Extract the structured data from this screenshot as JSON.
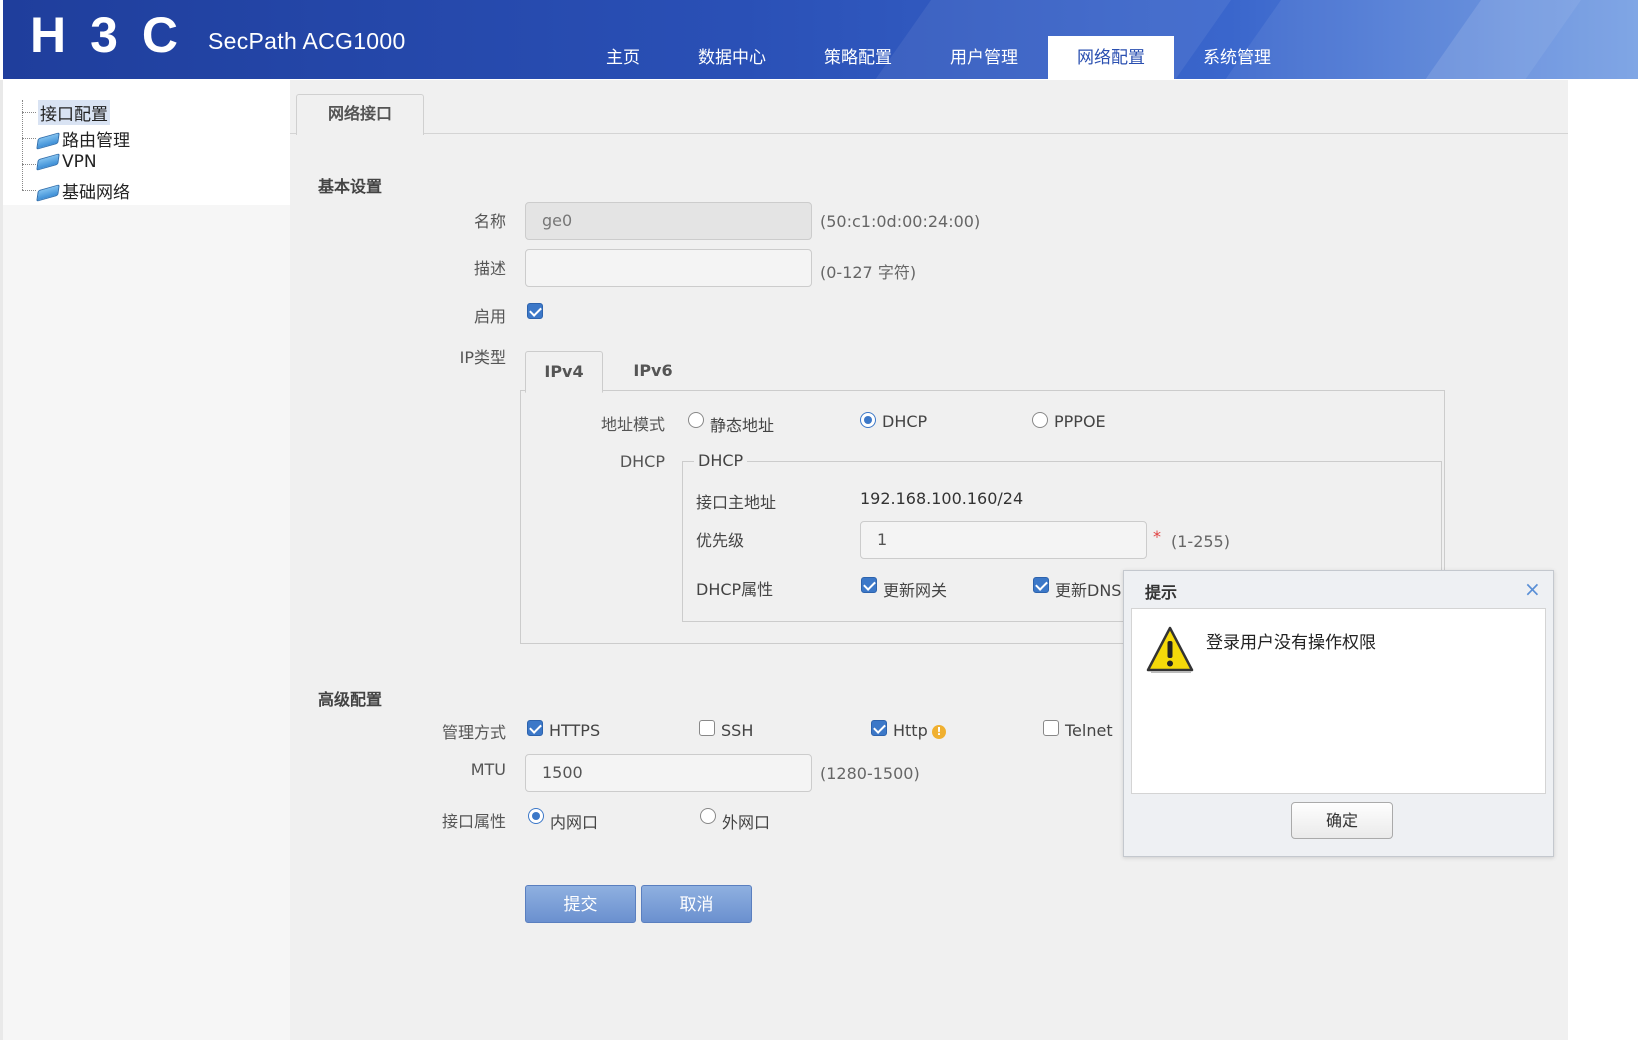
{
  "header": {
    "logo_text": "H3C",
    "product": "SecPath ACG1000",
    "nav": [
      "主页",
      "数据中心",
      "策略配置",
      "用户管理",
      "网络配置",
      "系统管理"
    ],
    "active_nav": "网络配置"
  },
  "sidebar": {
    "items": [
      {
        "label": "接口配置",
        "selected": true
      },
      {
        "label": "路由管理"
      },
      {
        "label": "VPN"
      },
      {
        "label": "基础网络"
      }
    ]
  },
  "tab": {
    "label": "网络接口"
  },
  "basic": {
    "title": "基本设置",
    "name_label": "名称",
    "name_value": "ge0",
    "name_hint": "(50:c1:0d:00:24:00)",
    "desc_label": "描述",
    "desc_value": "",
    "desc_hint": "(0-127 字符)",
    "enable_label": "启用",
    "enable_checked": true,
    "iptype_label": "IP类型",
    "ip_tabs": [
      "IPv4",
      "IPv6"
    ],
    "addr_mode_label": "地址模式",
    "addr_modes": [
      {
        "label": "静态地址",
        "selected": false
      },
      {
        "label": "DHCP",
        "selected": true
      },
      {
        "label": "PPPOE",
        "selected": false
      }
    ],
    "dhcp_label": "DHCP",
    "dhcp_legend": "DHCP",
    "primary_addr_label": "接口主地址",
    "primary_addr_value": "192.168.100.160/24",
    "priority_label": "优先级",
    "priority_value": "1",
    "priority_required": "*",
    "priority_hint": "(1-255)",
    "dhcp_attr_label": "DHCP属性",
    "dhcp_attrs": [
      {
        "label": "更新网关",
        "checked": true
      },
      {
        "label": "更新DNS",
        "checked": true
      }
    ]
  },
  "advanced": {
    "title": "高级配置",
    "mgmt_label": "管理方式",
    "mgmt_options": [
      {
        "label": "HTTPS",
        "checked": true
      },
      {
        "label": "SSH",
        "checked": false
      },
      {
        "label": "Http",
        "checked": true
      },
      {
        "label": "Telnet",
        "checked": false
      }
    ],
    "mtu_label": "MTU",
    "mtu_value": "1500",
    "mtu_hint": "(1280-1500)",
    "iface_attr_label": "接口属性",
    "iface_attrs": [
      {
        "label": "内网口",
        "selected": true
      },
      {
        "label": "外网口",
        "selected": false
      }
    ]
  },
  "actions": {
    "submit": "提交",
    "cancel": "取消"
  },
  "dialog": {
    "title": "提示",
    "close": "×",
    "icon": "warning-icon",
    "message": "登录用户没有操作权限",
    "ok": "确定"
  },
  "colors": {
    "header_blue": "#2a50b6",
    "accent": "#3c78c8",
    "button_blue": "#7b9fd8"
  }
}
